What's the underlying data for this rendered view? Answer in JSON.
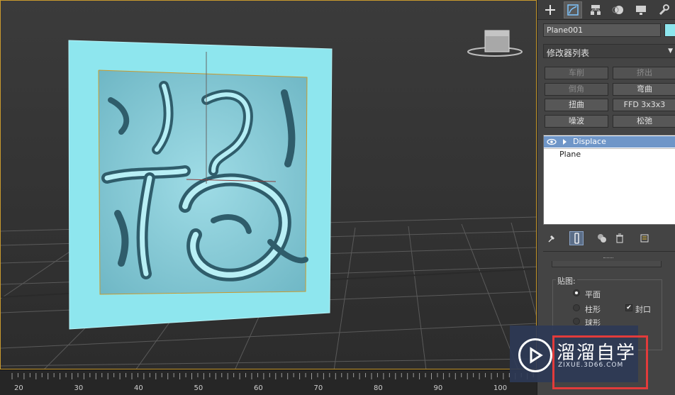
{
  "viewport": {
    "grid_color": "#5a5a5a",
    "plane_color": "#8ee6ee",
    "frame_color": "#c99a2e"
  },
  "timeline": {
    "ticks": [
      "20",
      "30",
      "40",
      "50",
      "60",
      "70",
      "80",
      "90",
      "100"
    ]
  },
  "panel": {
    "tabs": [
      "create-icon",
      "modify-icon",
      "hierarchy-icon",
      "motion-icon",
      "display-icon",
      "utilities-icon"
    ],
    "object_name": "Plane001",
    "object_color": "#8ee6ee",
    "modifier_list_label": "修改器列表",
    "modifier_buttons": [
      {
        "label": "车削",
        "enabled": false
      },
      {
        "label": "挤出",
        "enabled": false
      },
      {
        "label": "倒角",
        "enabled": false
      },
      {
        "label": "弯曲",
        "enabled": true
      },
      {
        "label": "扭曲",
        "enabled": true
      },
      {
        "label": "FFD 3x3x3",
        "enabled": true
      },
      {
        "label": "噪波",
        "enabled": true
      },
      {
        "label": "松弛",
        "enabled": true
      }
    ],
    "stack": {
      "active_modifier": "Displace",
      "base_object": "Plane"
    },
    "stack_tools": [
      "pin-stack-icon",
      "show-end-result-icon",
      "make-unique-icon",
      "remove-modifier-icon",
      "configure-sets-icon"
    ],
    "map_group": {
      "label": "贴图:",
      "options": [
        {
          "label": "平面",
          "selected": true
        },
        {
          "label": "柱形",
          "selected": false
        },
        {
          "label": "球形",
          "selected": false
        }
      ],
      "cap_label": "封口",
      "cap_checked": true
    }
  },
  "watermark": {
    "brand": "溜溜自学",
    "url": "ZIXUE.3D66.COM"
  }
}
